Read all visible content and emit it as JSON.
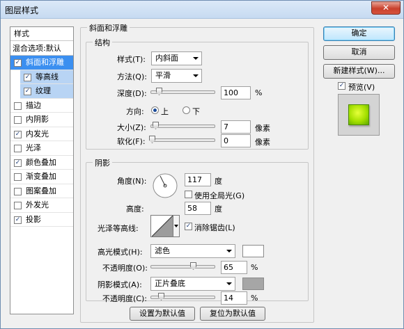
{
  "window": {
    "title": "图层样式",
    "close": "✕"
  },
  "left_list": {
    "header": "样式",
    "blend": "混合选项:默认",
    "items": [
      {
        "label": "斜面和浮雕",
        "checked": true
      },
      {
        "label": "等高线",
        "checked": true
      },
      {
        "label": "纹理",
        "checked": true
      },
      {
        "label": "描边",
        "checked": false
      },
      {
        "label": "内阴影",
        "checked": false
      },
      {
        "label": "内发光",
        "checked": true
      },
      {
        "label": "光泽",
        "checked": false
      },
      {
        "label": "颜色叠加",
        "checked": true
      },
      {
        "label": "渐变叠加",
        "checked": false
      },
      {
        "label": "图案叠加",
        "checked": false
      },
      {
        "label": "外发光",
        "checked": false
      },
      {
        "label": "投影",
        "checked": true
      }
    ]
  },
  "bevel": {
    "title": "斜面和浮雕",
    "structure": {
      "title": "结构",
      "style_label": "样式(T):",
      "style_value": "内斜面",
      "technique_label": "方法(Q):",
      "technique_value": "平滑",
      "depth_label": "深度(D):",
      "depth_value": "100",
      "depth_unit": "%",
      "direction_label": "方向:",
      "direction_up": "上",
      "direction_down": "下",
      "size_label": "大小(Z):",
      "size_value": "7",
      "size_unit": "像素",
      "soften_label": "软化(F):",
      "soften_value": "0",
      "soften_unit": "像素"
    },
    "shading": {
      "title": "阴影",
      "angle_label": "角度(N):",
      "angle_value": "117",
      "angle_unit": "度",
      "global_light_label": "使用全局光(G)",
      "altitude_label": "高度:",
      "altitude_value": "58",
      "altitude_unit": "度",
      "gloss_label": "光泽等高线:",
      "antialias_label": "消除锯齿(L)",
      "highlight_mode_label": "高光模式(H):",
      "highlight_mode_value": "滤色",
      "highlight_color": "#ffffff",
      "highlight_opacity_label": "不透明度(O):",
      "highlight_opacity_value": "65",
      "shadow_mode_label": "阴影模式(A):",
      "shadow_mode_value": "正片叠底",
      "shadow_color": "#a6a6a6",
      "shadow_opacity_label": "不透明度(C):",
      "shadow_opacity_value": "14",
      "percent": "%"
    },
    "make_default": "设置为默认值",
    "reset_default": "复位为默认值"
  },
  "right_buttons": {
    "ok": "确定",
    "cancel": "取消",
    "new_style": "新建样式(W)...",
    "preview_label": "预览(V)"
  }
}
